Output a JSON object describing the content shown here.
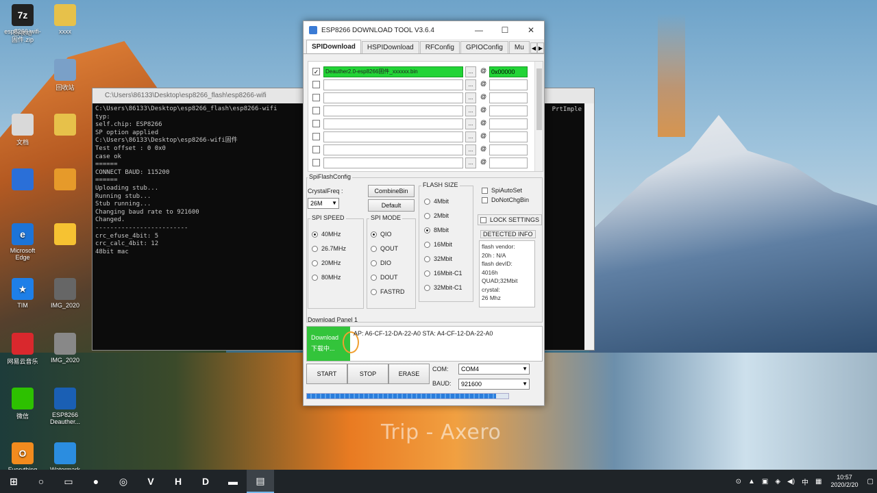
{
  "desktop": {
    "watermark": "Trip - Axero",
    "icons": [
      {
        "label": "回收站",
        "icon": "pc-icon"
      },
      {
        "label": "xxxx",
        "icon": "folder-icon"
      },
      {
        "label": "esp8266-wifi-\n固件.zip",
        "icon": "7zip-icon",
        "glyph": "7z"
      },
      {
        "label": "回收站",
        "icon": "recycle-bin-icon"
      },
      {
        "label": "文档",
        "icon": "document-icon"
      },
      {
        "label": "",
        "icon": "folder-icon"
      },
      {
        "label": "",
        "icon": "app-icon"
      },
      {
        "label": "",
        "icon": "app-icon"
      },
      {
        "label": "Microsoft\nEdge",
        "icon": "edge-icon",
        "glyph": "e"
      },
      {
        "label": "",
        "icon": "star-icon"
      },
      {
        "label": "TIM",
        "icon": "tim-icon",
        "glyph": "★"
      },
      {
        "label": "IMG_2020",
        "icon": "image-icon"
      },
      {
        "label": "网易云音乐",
        "icon": "netease-music-icon"
      },
      {
        "label": "IMG_2020",
        "icon": "image-icon"
      },
      {
        "label": "微信",
        "icon": "wechat-icon"
      },
      {
        "label": "ESP8266\nDeauther...",
        "icon": "esp-icon"
      },
      {
        "label": "Everything",
        "icon": "everything-icon",
        "glyph": "O"
      },
      {
        "label": "Watermark\nImage",
        "icon": "watermark-icon"
      }
    ]
  },
  "console": {
    "title": "C:\\Users\\86133\\Desktop\\esp8266_flash\\esp8266-wifi",
    "right_text": "PrtImple",
    "lines": [
      "C:\\Users\\86133\\Desktop\\esp8266_flash\\esp8266-wifi",
      "typ:",
      "  self.chip: ESP8266",
      "SP option applied",
      "C:\\Users\\86133\\Desktop\\esp8266-wifi固件",
      "Test offset : 0 0x0",
      "case ok",
      "======",
      "CONNECT BAUD: 115200",
      "======",
      "Uploading stub...",
      "Running stub...",
      "Stub running...",
      "Changing baud rate to 921600",
      "Changed.",
      "-------------------------",
      "crc_efuse_4bit: 5",
      "crc_calc_4bit: 12",
      "48bit mac"
    ]
  },
  "esp": {
    "title": "ESP8266 DOWNLOAD TOOL V3.6.4",
    "controls": [
      "—",
      "☐",
      "✕"
    ],
    "tabs": [
      "SPIDownload",
      "HSPIDownload",
      "RFConfig",
      "GPIOConfig",
      "Mu"
    ],
    "tab_arrows": [
      "◀",
      "▶"
    ],
    "files": [
      {
        "checked": true,
        "path": "Deauther2.0-esp8266固件_xxxxxx.bin",
        "addr": "0x00000"
      },
      {
        "checked": false,
        "path": "",
        "addr": ""
      },
      {
        "checked": false,
        "path": "",
        "addr": ""
      },
      {
        "checked": false,
        "path": "",
        "addr": ""
      },
      {
        "checked": false,
        "path": "",
        "addr": ""
      },
      {
        "checked": false,
        "path": "",
        "addr": ""
      },
      {
        "checked": false,
        "path": "",
        "addr": ""
      },
      {
        "checked": false,
        "path": "",
        "addr": ""
      }
    ],
    "browse_label": "...",
    "at_label": "@",
    "spiflash_config_label": "SpiFlashConfig",
    "crystal_label": "CrystalFreq :",
    "crystal_value": "26M",
    "combine_label": "CombineBin",
    "default_label": "Default",
    "flash_size_label": "FLASH SIZE",
    "flash_sizes": [
      {
        "label": "4Mbit",
        "on": false
      },
      {
        "label": "2Mbit",
        "on": false
      },
      {
        "label": "8Mbit",
        "on": true
      },
      {
        "label": "16Mbit",
        "on": false
      },
      {
        "label": "32Mbit",
        "on": false
      },
      {
        "label": "16Mbit-C1",
        "on": false
      },
      {
        "label": "32Mbit-C1",
        "on": false
      }
    ],
    "spi_auto_set": "SpiAutoSet",
    "do_not_chg_bin": "DoNotChgBin",
    "lock_settings": "LOCK SETTINGS",
    "spi_speed_label": "SPI SPEED",
    "spi_speeds": [
      {
        "label": "40MHz",
        "on": true
      },
      {
        "label": "26.7MHz",
        "on": false
      },
      {
        "label": "20MHz",
        "on": false
      },
      {
        "label": "80MHz",
        "on": false
      }
    ],
    "spi_mode_label": "SPI MODE",
    "spi_modes": [
      {
        "label": "QIO",
        "on": true
      },
      {
        "label": "QOUT",
        "on": false
      },
      {
        "label": "DIO",
        "on": false
      },
      {
        "label": "DOUT",
        "on": false
      },
      {
        "label": "FASTRD",
        "on": false
      }
    ],
    "detected_info_label": "DETECTED INFO",
    "detected_info": "flash vendor:\n20h : N/A\nflash devID:\n4016h\nQUAD;32Mbit\ncrystal:\n26 Mhz",
    "download_panel_label": "Download Panel 1",
    "download_status": "Download",
    "download_status_2": "下载中...",
    "mac_text": "AP:  A6-CF-12-DA-22-A0   STA:  A4-CF-12-DA-22-A0",
    "start_label": "START",
    "stop_label": "STOP",
    "erase_label": "ERASE",
    "com_label": "COM:",
    "com_value": "COM4",
    "baud_label": "BAUD:",
    "baud_value": "921600",
    "progress": 0.94
  },
  "taskbar": {
    "apps": [
      {
        "icon": "windows-start-icon",
        "glyph": "⊞"
      },
      {
        "icon": "search-icon",
        "glyph": "○"
      },
      {
        "icon": "task-view-icon",
        "glyph": "▭"
      },
      {
        "icon": "firefox-icon",
        "glyph": "●"
      },
      {
        "icon": "netease-music-taskbar-icon",
        "glyph": "◎"
      },
      {
        "icon": "vim-icon",
        "glyph": "V"
      },
      {
        "icon": "h-app-icon",
        "glyph": "H"
      },
      {
        "icon": "db-app-icon",
        "glyph": "D"
      },
      {
        "icon": "file-explorer-icon",
        "glyph": "▬"
      },
      {
        "icon": "esp-download-tool-icon",
        "glyph": "▤"
      }
    ],
    "tray": [
      "⊙",
      "▲",
      "▣",
      "◈",
      "◀)",
      "中",
      "▦"
    ],
    "time": "10:57",
    "date": "2020/2/20",
    "notify_glyph": "▢"
  }
}
